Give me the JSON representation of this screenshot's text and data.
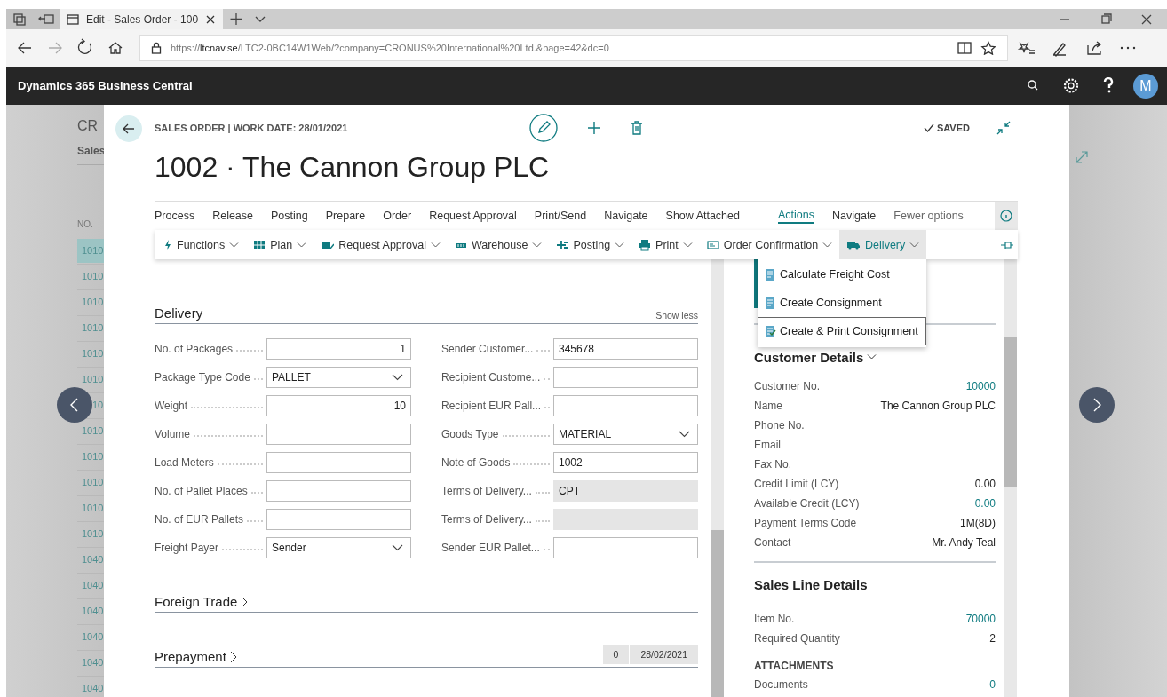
{
  "browser": {
    "tab_title": "Edit - Sales Order - 100",
    "url_scheme": "https://",
    "url_host": "ltcnav.se",
    "url_path": "/LTC2-0BC14W1Web/?company=CRONUS%20International%20Ltd.&page=42&dc=0"
  },
  "app_bar": {
    "title": "Dynamics 365 Business Central",
    "avatar": "M"
  },
  "background_page": {
    "title": "CR",
    "subtitle": "Sales",
    "column": "NO.",
    "rows": [
      {
        "no": "1010",
        "selected": true
      },
      {
        "no": "1010",
        "selected": false
      },
      {
        "no": "1010",
        "selected": false
      },
      {
        "no": "1010",
        "selected": false
      },
      {
        "no": "1010",
        "selected": false
      },
      {
        "no": "1010",
        "selected": false
      },
      {
        "no": "10",
        "kind": "clipped",
        "selected": false
      },
      {
        "no": "1010",
        "selected": false
      },
      {
        "no": "1010",
        "selected": false
      },
      {
        "no": "1010",
        "selected": false
      },
      {
        "no": "1010",
        "selected": false
      },
      {
        "no": "1010",
        "selected": false
      },
      {
        "no": "1040",
        "selected": false
      },
      {
        "no": "1040",
        "selected": false
      },
      {
        "no": "1040",
        "selected": false
      },
      {
        "no": "1040",
        "selected": false
      },
      {
        "no": "1040",
        "selected": false
      },
      {
        "no": "1040",
        "selected": false
      }
    ]
  },
  "card": {
    "caption": "SALES ORDER | WORK DATE: 28/01/2021",
    "title": "1002 · The Cannon Group PLC",
    "status": "SAVED"
  },
  "action_tabs": [
    {
      "label": "Process",
      "selected": false
    },
    {
      "label": "Release",
      "selected": false
    },
    {
      "label": "Posting",
      "selected": false
    },
    {
      "label": "Prepare",
      "selected": false
    },
    {
      "label": "Order",
      "selected": false
    },
    {
      "label": "Request Approval",
      "selected": false
    },
    {
      "label": "Print/Send",
      "selected": false
    },
    {
      "label": "Navigate",
      "selected": false
    },
    {
      "label": "Show Attached",
      "selected": false
    },
    {
      "label": "Actions",
      "selected": true
    },
    {
      "label": "Navigate",
      "selected": false
    }
  ],
  "fewer_options": "Fewer options",
  "commands": [
    {
      "label": "Functions",
      "selected": false
    },
    {
      "label": "Plan",
      "selected": false
    },
    {
      "label": "Request Approval",
      "selected": false
    },
    {
      "label": "Warehouse",
      "selected": false
    },
    {
      "label": "Posting",
      "selected": false
    },
    {
      "label": "Print",
      "selected": false
    },
    {
      "label": "Order Confirmation",
      "selected": false
    },
    {
      "label": "Delivery",
      "selected": true
    }
  ],
  "delivery_menu": [
    {
      "label": "Calculate Freight Cost",
      "selected": false
    },
    {
      "label": "Create Consignment",
      "selected": false
    },
    {
      "label": "Create & Print Consignment",
      "selected": true
    }
  ],
  "delivery": {
    "title": "Delivery",
    "toggle": "Show less",
    "fields_left": [
      {
        "label": "No. of Packages",
        "value": "1",
        "kind": "number"
      },
      {
        "label": "Package Type Code",
        "value": "PALLET",
        "kind": "dropdown"
      },
      {
        "label": "Weight",
        "value": "10",
        "kind": "number"
      },
      {
        "label": "Volume",
        "kind": "text"
      },
      {
        "label": "Load Meters",
        "kind": "text"
      },
      {
        "label": "No. of Pallet Places",
        "kind": "text"
      },
      {
        "label": "No. of EUR Pallets",
        "kind": "text"
      },
      {
        "label": "Freight Payer",
        "value": "Sender",
        "kind": "dropdown"
      }
    ],
    "fields_right": [
      {
        "label": "Sender Customer...",
        "value": "345678",
        "kind": "text"
      },
      {
        "label": "Recipient Custome...",
        "kind": "text"
      },
      {
        "label": "Recipient EUR Pall...",
        "kind": "text"
      },
      {
        "label": "Goods Type",
        "value": "MATERIAL",
        "kind": "dropdown"
      },
      {
        "label": "Note of Goods",
        "value": "1002",
        "kind": "text"
      },
      {
        "label": "Terms of Delivery...",
        "value": "CPT",
        "kind": "readonly"
      },
      {
        "label": "Terms of Delivery...",
        "kind": "readonly"
      },
      {
        "label": "Sender EUR Pallet...",
        "kind": "text"
      }
    ]
  },
  "collapsed_sections": [
    {
      "title": "Foreign Trade"
    },
    {
      "title": "Prepayment",
      "summary": [
        "0",
        "28/02/2021"
      ]
    }
  ],
  "factbox": {
    "customer_title": "Customer Details",
    "customer_rows": [
      {
        "label": "Customer No.",
        "value": "10000",
        "link": true
      },
      {
        "label": "Name",
        "value": "The Cannon Group PLC",
        "link": false
      },
      {
        "label": "Phone No.",
        "link": false
      },
      {
        "label": "Email",
        "link": false
      },
      {
        "label": "Fax No.",
        "link": false
      },
      {
        "label": "Credit Limit (LCY)",
        "value": "0.00",
        "link": false
      },
      {
        "label": "Available Credit (LCY)",
        "value": "0.00",
        "link": true
      },
      {
        "label": "Payment Terms Code",
        "value": "1M(8D)",
        "link": false
      },
      {
        "label": "Contact",
        "value": "Mr. Andy Teal",
        "link": false
      }
    ],
    "sales_line_title": "Sales Line Details",
    "sales_line_rows": [
      {
        "label": "Item No.",
        "value": "70000",
        "link": true
      },
      {
        "label": "Required Quantity",
        "value": "2",
        "link": false
      }
    ],
    "attachments_title": "ATTACHMENTS",
    "attachment_rows": [
      {
        "label": "Documents",
        "value": "0",
        "link": true
      }
    ]
  }
}
